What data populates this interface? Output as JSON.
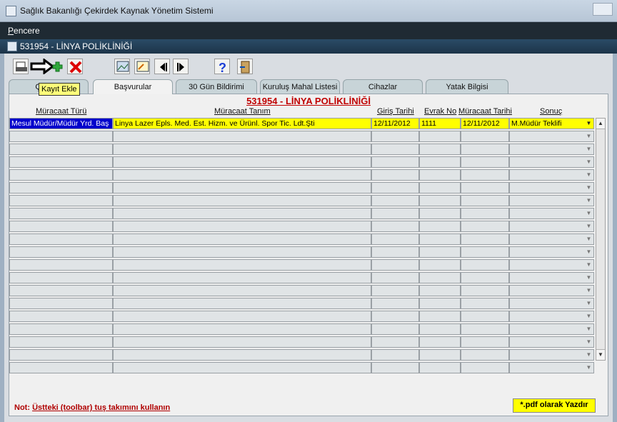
{
  "window": {
    "title": "Sağlık Bakanlığı Çekirdek Kaynak Yönetim Sistemi"
  },
  "menu": {
    "items": [
      "Pencere"
    ]
  },
  "child_window": {
    "title": "531954 - LİNYA POLİKLİNİĞİ"
  },
  "toolbar": {
    "buttons": [
      "print-icon",
      "add-record-icon",
      "delete-record-icon",
      "image-icon",
      "image-edit-icon",
      "previous-icon",
      "next-icon",
      "help-icon",
      "exit-icon"
    ],
    "tooltip": "Kayıt Ekle"
  },
  "tabs": [
    {
      "label": "Çalışan"
    },
    {
      "label": "Başvurular"
    },
    {
      "label": "30 Gün Bildirimi"
    },
    {
      "label": "Kuruluş Mahal Listesi"
    },
    {
      "label": "Cihazlar"
    },
    {
      "label": "Yatak Bilgisi"
    }
  ],
  "record_title": "531954 - LİNYA POLİKLİNİĞİ",
  "table": {
    "columns": [
      "Müracaat Türü",
      "Müracaat Tanım",
      "Giriş Tarihi",
      "Evrak No",
      "Müracaat Tarihi",
      "Sonuç"
    ],
    "rows": [
      [
        "Mesul Müdür/Müdür Yrd. Baş",
        "Linya Lazer Epls. Med. Est. Hizm. ve Ürünl. Spor Tic. Ldt.Şti",
        "12/11/2012",
        "1111",
        "12/11/2012",
        "M.Müdür Teklifi"
      ]
    ],
    "empty_row_count": 19
  },
  "note": {
    "label": "Not:",
    "text": "Üstteki (toolbar) tuş takımını kullanın"
  },
  "pdf_button": "*.pdf olarak Yazdır",
  "colors": {
    "current_row": "#ffff00",
    "selected_cell": "#0000cc",
    "title_red": "#c00000"
  }
}
